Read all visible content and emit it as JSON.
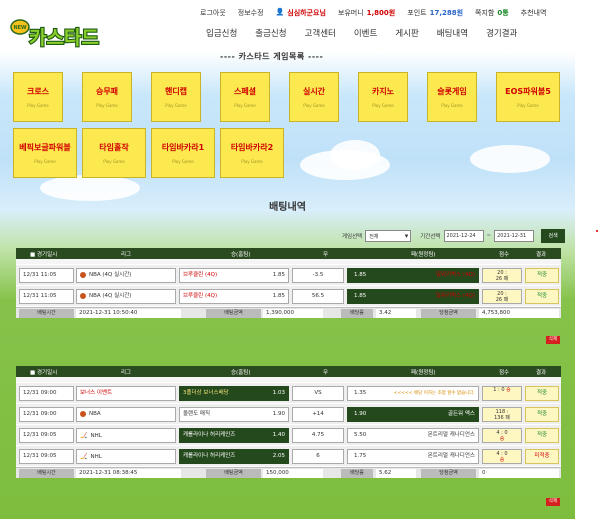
{
  "brand": {
    "logo_text": "카스타드",
    "logo_small": "NEW"
  },
  "topbar": {
    "logout": "로그아웃",
    "edit_info": "정보수정",
    "user": "심심하군요님",
    "money_label": "보유머니",
    "money_value": "1,800원",
    "point_label": "포인트",
    "point_value": "17,288원",
    "notes_label": "쪽지함",
    "notes_value": "0통",
    "recommend": "추천내역"
  },
  "nav": [
    "입금신청",
    "출금신청",
    "고객센터",
    "이벤트",
    "게시판",
    "배팅내역",
    "경기결과"
  ],
  "games_title": "---- 카스타드 게임목록 ----",
  "games_sub": "Play Game",
  "games": [
    "크로스",
    "승무패",
    "핸디캡",
    "스페셜",
    "실시간",
    "카지노",
    "슬롯게임",
    "EOS파워볼5",
    "베픽보글파워볼",
    "타임홀작",
    "타임바카라1",
    "타임바카라2"
  ],
  "page_title": "배팅내역",
  "filter": {
    "type_label": "게임선택",
    "type_value": "전체",
    "period_label": "기간선택",
    "date_from": "2021-12-24",
    "date_sep": "~",
    "date_to": "2021-12-31",
    "search": "검색"
  },
  "columns": [
    "경기일시",
    "리그",
    "승(홈팀)",
    "무",
    "패(원정팀)",
    "점수",
    "결과"
  ],
  "foot_labels": {
    "bet_time": "배팅시간",
    "bet_amount": "배팅금액",
    "odds": "배당률",
    "win_amount": "당첨금액"
  },
  "delete_label": "삭제",
  "tables": [
    {
      "rows": [
        {
          "date": "12/31 11:05",
          "league": "NBA (4Q 실시간)",
          "home": "브루클린 (4Q)",
          "home_odds": "1.85",
          "mid": "-3.5",
          "away_odds": "1.85",
          "away": "밀워키벅스 (4Q)",
          "score": [
            "20 :",
            "26 패"
          ],
          "result": "적중"
        },
        {
          "date": "12/31 11:05",
          "league": "NBA (4Q 실시간)",
          "home": "브루클린 (4Q)",
          "home_odds": "1.85",
          "mid": "56.5",
          "away_odds": "1.85",
          "away": "밀워키벅스 (4Q)",
          "score": [
            "20 :",
            "26 패"
          ],
          "result": "적중"
        }
      ],
      "foot": {
        "bet_time": "2021-12-31 10:50:40",
        "bet_amount": "1,390,000",
        "odds": "3.42",
        "win_amount": "4,753,800"
      }
    },
    {
      "rows": [
        {
          "date": "12/31 09:00",
          "league": "보너스 이벤트",
          "home": "3폴더상 보너스배당",
          "home_odds": "1.03",
          "mid": "VS",
          "away_odds": "1.35",
          "away": "<<<<< 배당 이하는 조합 할수 없습니다.",
          "score": [
            "1 : 0",
            "승"
          ],
          "result": "적중"
        },
        {
          "date": "12/31 09:00",
          "league": "NBA",
          "home": "올랜도 매직",
          "home_odds": "1.90",
          "mid": "+14",
          "away_odds": "1.90",
          "away": "골든워 액스",
          "score": [
            "118 :",
            "136 패"
          ],
          "result": "적중"
        },
        {
          "date": "12/31 09:05",
          "league": "NHL",
          "home": "캐롤라이나 허리케인즈",
          "home_odds": "1.40",
          "mid": "4.75",
          "away_odds": "5.50",
          "away": "몬트리얼 캐나디언스",
          "score": [
            "4 : 0",
            "승"
          ],
          "result": "적중"
        },
        {
          "date": "12/31 09:05",
          "league": "NHL",
          "home": "캐롤라이나 허리케인즈",
          "home_odds": "2.05",
          "mid": "6",
          "away_odds": "1.75",
          "away": "몬트리얼 캐나디언스",
          "score": [
            "4 : 0",
            "승"
          ],
          "result": "미적중"
        }
      ],
      "foot": {
        "bet_time": "2021-12-31 08:38:45",
        "bet_amount": "150,000",
        "odds": "5.62",
        "win_amount": "0"
      }
    }
  ],
  "colors": {
    "tile_bg": "#fce94f",
    "tile_text": "#d00000",
    "table_header": "#2a4a20",
    "delete": "#d62020"
  }
}
